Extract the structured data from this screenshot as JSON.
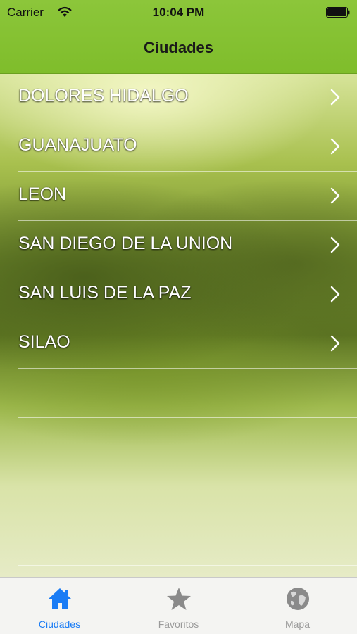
{
  "status_bar": {
    "carrier": "Carrier",
    "time": "10:04 PM"
  },
  "nav": {
    "title": "Ciudades"
  },
  "cities": [
    {
      "label": "DOLORES HIDALGO"
    },
    {
      "label": "GUANAJUATO"
    },
    {
      "label": "LEON"
    },
    {
      "label": "SAN DIEGO DE LA UNION"
    },
    {
      "label": "SAN LUIS DE LA PAZ"
    },
    {
      "label": "SILAO"
    }
  ],
  "tab_bar": {
    "tabs": [
      {
        "label": "Ciudades",
        "icon": "home-icon",
        "active": true
      },
      {
        "label": "Favoritos",
        "icon": "star-icon",
        "active": false
      },
      {
        "label": "Mapa",
        "icon": "globe-icon",
        "active": false
      }
    ]
  },
  "colors": {
    "header": "#8cc63a",
    "active_tab": "#1a7cf5",
    "inactive_tab": "#9a9a9a"
  }
}
